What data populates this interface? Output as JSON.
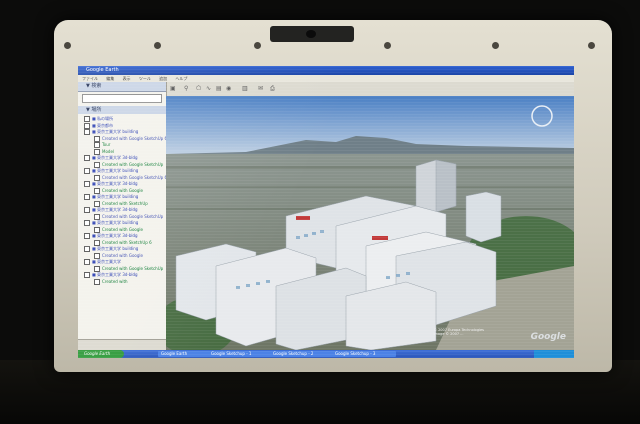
{
  "window": {
    "title": "Google Earth"
  },
  "menu": [
    "ファイル",
    "編集",
    "表示",
    "ツール",
    "追加",
    "ヘルプ"
  ],
  "sidebar": {
    "search_header": "▼ 検索",
    "search_placeholder": "",
    "places_header": "▼ 場所",
    "tree": [
      {
        "label": "■ 私の場所",
        "level": 0
      },
      {
        "label": "■ 東京都市",
        "level": 0
      },
      {
        "label": "■ 東京工業大学 building",
        "level": 0
      },
      {
        "label": "Created with Google SketchUp 6 Pro",
        "level": 1
      },
      {
        "label": "Tour",
        "level": 1
      },
      {
        "label": "Model",
        "level": 1
      },
      {
        "label": "■ 東京工業大学 3d-bldg",
        "level": 0
      },
      {
        "label": "Created with Google SketchUp",
        "level": 1
      },
      {
        "label": "■ 東京工業大学 building",
        "level": 0
      },
      {
        "label": "Created with Google SketchUp 6",
        "level": 1
      },
      {
        "label": "■ 東京工業大学 3d-bldg",
        "level": 0
      },
      {
        "label": "Created with Google",
        "level": 1
      },
      {
        "label": "■ 東京工業大学 building",
        "level": 0
      },
      {
        "label": "Created with SketchUp",
        "level": 1
      },
      {
        "label": "■ 東京工業大学 3d-bldg",
        "level": 0
      },
      {
        "label": "Created with Google SketchUp",
        "level": 1
      },
      {
        "label": "■ 東京工業大学 building",
        "level": 0
      },
      {
        "label": "Created with Google",
        "level": 1
      },
      {
        "label": "■ 東京工業大学 3d-bldg",
        "level": 0
      },
      {
        "label": "Created with SketchUp 6",
        "level": 1
      },
      {
        "label": "■ 東京工業大学 building",
        "level": 0
      },
      {
        "label": "Created with Google",
        "level": 1
      },
      {
        "label": "■ 東京工業大学",
        "level": 0
      },
      {
        "label": "Created with Google SketchUp",
        "level": 1
      },
      {
        "label": "■ 東京工業大学 3d-bldg",
        "level": 0
      },
      {
        "label": "Created with",
        "level": 1
      }
    ]
  },
  "viewport": {
    "copyright_lines": [
      "© 2007 Europa Technologies",
      "Image © 2007 ..."
    ],
    "logo": "Google"
  },
  "taskbar": {
    "start": "Google Earth",
    "tasks": [
      "Google Earth",
      "Google Sketchup - 1",
      "Google Sketchup - 2",
      "Google Sketchup - 3"
    ]
  },
  "colors": {
    "sky_top": "#4a7fc4",
    "sky_bottom": "#b8c9de",
    "building": "#d9dfe4",
    "xp_blue": "#2a55b8"
  }
}
